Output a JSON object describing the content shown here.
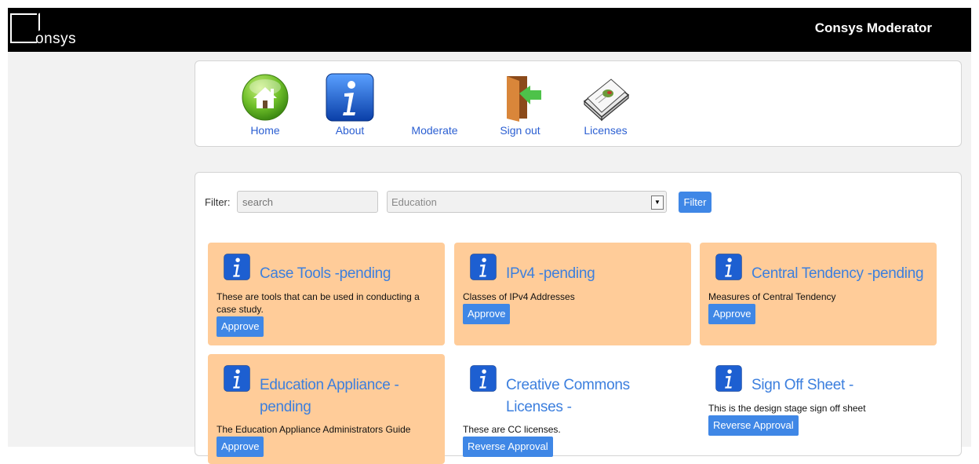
{
  "header": {
    "logo_text": "onsys",
    "title": "Consys Moderator"
  },
  "nav": {
    "items": [
      {
        "label": "Home",
        "icon": "home-icon"
      },
      {
        "label": "About",
        "icon": "info-icon"
      },
      {
        "label": "Moderate",
        "icon": "none"
      },
      {
        "label": "Sign out",
        "icon": "sign-out-icon"
      },
      {
        "label": "Licenses",
        "icon": "licenses-icon"
      }
    ]
  },
  "filter": {
    "label": "Filter:",
    "search_placeholder": "search",
    "category_selected": "Education",
    "button_label": "Filter"
  },
  "cards": [
    {
      "title": "Case Tools -pending",
      "description": "These are tools that can be used in conducting a case study.",
      "action": "Approve",
      "status": "pending"
    },
    {
      "title": "IPv4 -pending",
      "description": "Classes of IPv4 Addresses",
      "action": "Approve",
      "status": "pending"
    },
    {
      "title": "Central Tendency -pending",
      "description": "Measures of Central Tendency",
      "action": "Approve",
      "status": "pending"
    },
    {
      "title": "Education Appliance - pending",
      "description": "The Education Appliance Administrators Guide",
      "action": "Approve",
      "status": "pending"
    },
    {
      "title": "Creative Commons Licenses -",
      "description": "These are CC licenses.",
      "action": "Reverse Approval",
      "status": "approved"
    },
    {
      "title": "Sign Off Sheet -",
      "description": "This is the design stage sign off sheet",
      "action": "Reverse Approval",
      "status": "approved"
    }
  ],
  "colors": {
    "pending_bg": "#ffcc99",
    "accent": "#3f87e6",
    "title_blue": "#3c7fde"
  }
}
